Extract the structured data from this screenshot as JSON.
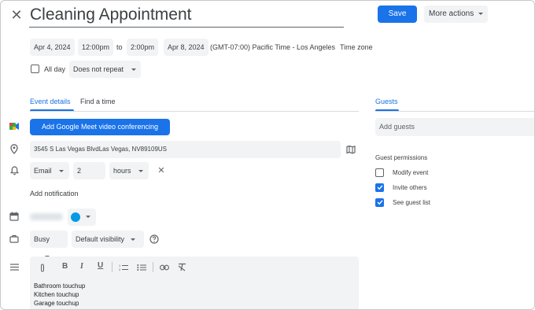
{
  "event": {
    "title": "Cleaning Appointment",
    "save_label": "Save",
    "more_actions_label": "More actions"
  },
  "datetime": {
    "start_date": "Apr 4, 2024",
    "start_time": "12:00pm",
    "to_label": "to",
    "end_time": "2:00pm",
    "end_date": "Apr 8, 2024",
    "timezone_value": "(GMT-07:00) Pacific Time - Los Angeles",
    "timezone_link": "Time zone",
    "all_day_label": "All day",
    "all_day_checked": false,
    "repeat_value": "Does not repeat"
  },
  "tabs": {
    "event_details": "Event details",
    "find_a_time": "Find a time"
  },
  "details": {
    "meet_button_label": "Add Google Meet video conferencing",
    "location_value": "3545 S Las Vegas BlvdLas Vegas, NV89109US",
    "notification_type": "Email",
    "notification_amount": "2",
    "notification_unit": "hours",
    "add_notification_label": "Add notification",
    "calendar_color": "#039be5",
    "availability_value": "Busy",
    "visibility_value": "Default visibility",
    "description_lines": {
      "line1": "Bathroom touchup",
      "line2": "Kitchen touchup",
      "line3": "Garage touchup"
    }
  },
  "guests": {
    "tab_label": "Guests",
    "add_placeholder": "Add guests",
    "permissions_title": "Guest permissions",
    "permissions": {
      "modify": {
        "label": "Modify event",
        "checked": false
      },
      "invite": {
        "label": "Invite others",
        "checked": true
      },
      "see_list": {
        "label": "See guest list",
        "checked": true
      }
    }
  },
  "colors": {
    "accent": "#1a73e8",
    "chip_bg": "#f1f3f4"
  }
}
